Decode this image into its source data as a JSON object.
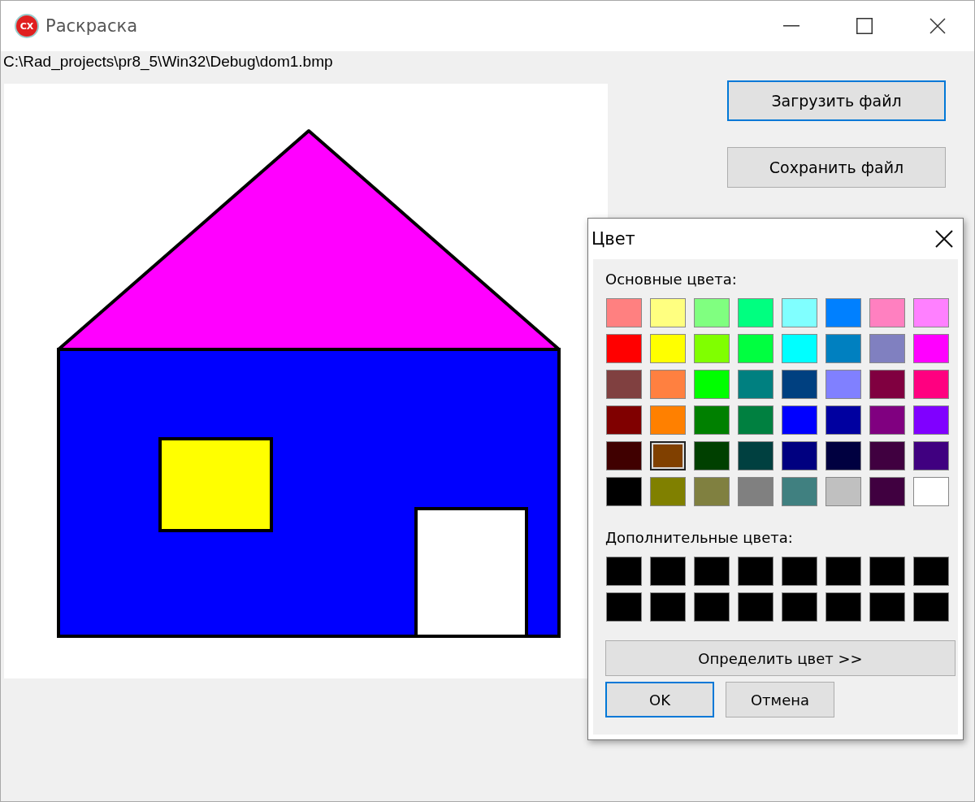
{
  "window": {
    "icon_label": "CX",
    "title": "Раскраска"
  },
  "file_path": "C:\\Rad_projects\\pr8_5\\Win32\\Debug\\dom1.bmp",
  "buttons": [
    {
      "label": "Загрузить файл",
      "default": true
    },
    {
      "label": "Сохранить файл",
      "default": false
    }
  ],
  "color_dialog": {
    "title": "Цвет",
    "basic_label": "Основные цвета:",
    "basic_colors": [
      {
        "color": "#ff8080",
        "selected": false
      },
      {
        "color": "#ffff80",
        "selected": false
      },
      {
        "color": "#80ff80",
        "selected": false
      },
      {
        "color": "#00ff80",
        "selected": false
      },
      {
        "color": "#80ffff",
        "selected": false
      },
      {
        "color": "#0080ff",
        "selected": false
      },
      {
        "color": "#ff80c0",
        "selected": false
      },
      {
        "color": "#ff80ff",
        "selected": false
      },
      {
        "color": "#ff0000",
        "selected": false
      },
      {
        "color": "#ffff00",
        "selected": false
      },
      {
        "color": "#80ff00",
        "selected": false
      },
      {
        "color": "#00ff40",
        "selected": false
      },
      {
        "color": "#00ffff",
        "selected": false
      },
      {
        "color": "#0080c0",
        "selected": false
      },
      {
        "color": "#8080c0",
        "selected": false
      },
      {
        "color": "#ff00ff",
        "selected": false
      },
      {
        "color": "#804040",
        "selected": false
      },
      {
        "color": "#ff8040",
        "selected": false
      },
      {
        "color": "#00ff00",
        "selected": false
      },
      {
        "color": "#008080",
        "selected": false
      },
      {
        "color": "#004080",
        "selected": false
      },
      {
        "color": "#8080ff",
        "selected": false
      },
      {
        "color": "#800040",
        "selected": false
      },
      {
        "color": "#ff0080",
        "selected": false
      },
      {
        "color": "#800000",
        "selected": false
      },
      {
        "color": "#ff8000",
        "selected": false
      },
      {
        "color": "#008000",
        "selected": false
      },
      {
        "color": "#008040",
        "selected": false
      },
      {
        "color": "#0000ff",
        "selected": false
      },
      {
        "color": "#0000a0",
        "selected": false
      },
      {
        "color": "#800080",
        "selected": false
      },
      {
        "color": "#8000ff",
        "selected": false
      },
      {
        "color": "#400000",
        "selected": false
      },
      {
        "color": "#804000",
        "selected": true
      },
      {
        "color": "#004000",
        "selected": false
      },
      {
        "color": "#004040",
        "selected": false
      },
      {
        "color": "#000080",
        "selected": false
      },
      {
        "color": "#000040",
        "selected": false
      },
      {
        "color": "#400040",
        "selected": false
      },
      {
        "color": "#400080",
        "selected": false
      },
      {
        "color": "#000000",
        "selected": false
      },
      {
        "color": "#808000",
        "selected": false
      },
      {
        "color": "#808040",
        "selected": false
      },
      {
        "color": "#808080",
        "selected": false
      },
      {
        "color": "#408080",
        "selected": false
      },
      {
        "color": "#c0c0c0",
        "selected": false
      },
      {
        "color": "#400040",
        "selected": false
      },
      {
        "color": "#ffffff",
        "selected": false
      }
    ],
    "custom_label": "Дополнительные цвета:",
    "custom_colors": [
      {
        "color": "#000000",
        "selected": false
      },
      {
        "color": "#000000",
        "selected": false
      },
      {
        "color": "#000000",
        "selected": false
      },
      {
        "color": "#000000",
        "selected": false
      },
      {
        "color": "#000000",
        "selected": false
      },
      {
        "color": "#000000",
        "selected": false
      },
      {
        "color": "#000000",
        "selected": false
      },
      {
        "color": "#000000",
        "selected": false
      },
      {
        "color": "#000000",
        "selected": false
      },
      {
        "color": "#000000",
        "selected": false
      },
      {
        "color": "#000000",
        "selected": false
      },
      {
        "color": "#000000",
        "selected": false
      },
      {
        "color": "#000000",
        "selected": false
      },
      {
        "color": "#000000",
        "selected": false
      },
      {
        "color": "#000000",
        "selected": false
      },
      {
        "color": "#000000",
        "selected": false
      }
    ],
    "define_button": "Определить цвет >>",
    "buttons": [
      {
        "label": "OK",
        "default": true
      },
      {
        "label": "Отмена",
        "default": false
      }
    ]
  }
}
